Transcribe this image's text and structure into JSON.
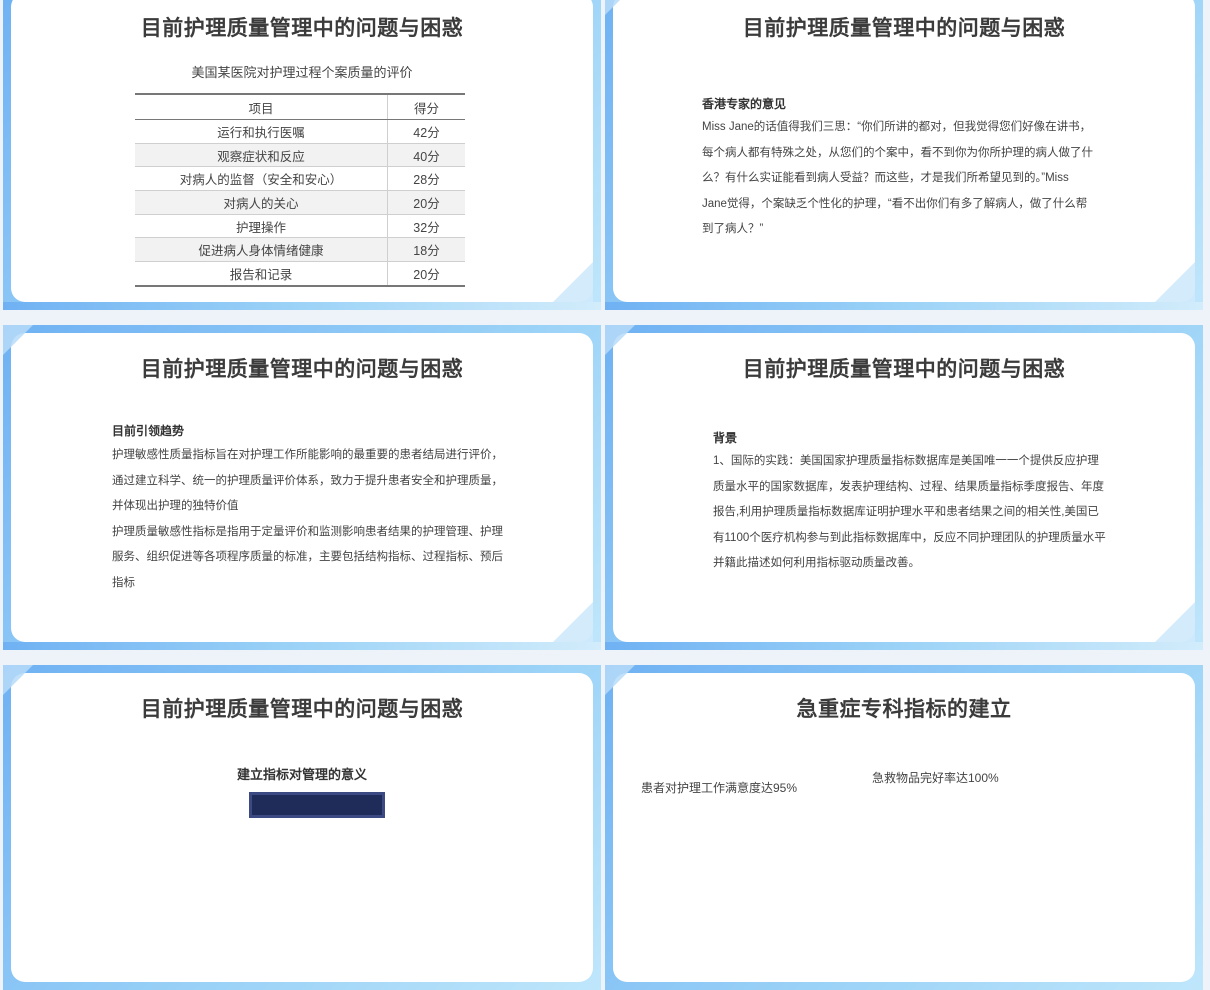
{
  "slides": [
    {
      "title": "目前护理质量管理中的问题与困惑",
      "subtitle": "美国某医院对护理过程个案质量的评价",
      "table": {
        "headers": [
          "项目",
          "得分"
        ],
        "rows": [
          [
            "运行和执行医嘱",
            "42分"
          ],
          [
            "观察症状和反应",
            "40分"
          ],
          [
            "对病人的监督（安全和安心）",
            "28分"
          ],
          [
            "对病人的关心",
            "20分"
          ],
          [
            "护理操作",
            "32分"
          ],
          [
            "促进病人身体情绪健康",
            "18分"
          ],
          [
            "报告和记录",
            "20分"
          ]
        ]
      }
    },
    {
      "title": "目前护理质量管理中的问题与困惑",
      "heading": "香港专家的意见",
      "lines": [
        "Miss Jane的话值得我们三思：“你们所讲的都对，但我觉得您们好像在讲书，",
        "每个病人都有特殊之处，从您们的个案中，看不到你为你所护理的病人做了什",
        "么？有什么实证能看到病人受益？而这些，才是我们所希望见到的。”Miss",
        "Jane觉得，个案缺乏个性化的护理，“看不出你们有多了解病人，做了什么帮",
        "到了病人？”"
      ]
    },
    {
      "title": "目前护理质量管理中的问题与困惑",
      "heading": "目前引领趋势",
      "lines": [
        "护理敏感性质量指标旨在对护理工作所能影响的最重要的患者结局进行评价，",
        "通过建立科学、统一的护理质量评价体系，致力于提升患者安全和护理质量，",
        "并体现出护理的独特价值",
        "护理质量敏感性指标是指用于定量评价和监测影响患者结果的护理管理、护理",
        "服务、组织促进等各项程序质量的标准，主要包括结构指标、过程指标、预后",
        "指标"
      ]
    },
    {
      "title": "目前护理质量管理中的问题与困惑",
      "heading": "背景",
      "lines": [
        "1、国际的实践：美国国家护理质量指标数据库是美国唯一一个提供反应护理",
        "质量水平的国家数据库，发表护理结构、过程、结果质量指标季度报告、年度",
        "报告,利用护理质量指标数据库证明护理水平和患者结果之间的相关性,美国已",
        "有1100个医疗机构参与到此指标数据库中，反应不同护理团队的护理质量水平",
        "并籍此描述如何利用指标驱动质量改善。"
      ]
    },
    {
      "title": "目前护理质量管理中的问题与困惑",
      "heading": "建立指标对管理的意义"
    },
    {
      "title": "急重症专科指标的建立",
      "left_item": "患者对护理工作满意度达95%",
      "right_item": "急救物品完好率达100%"
    }
  ]
}
